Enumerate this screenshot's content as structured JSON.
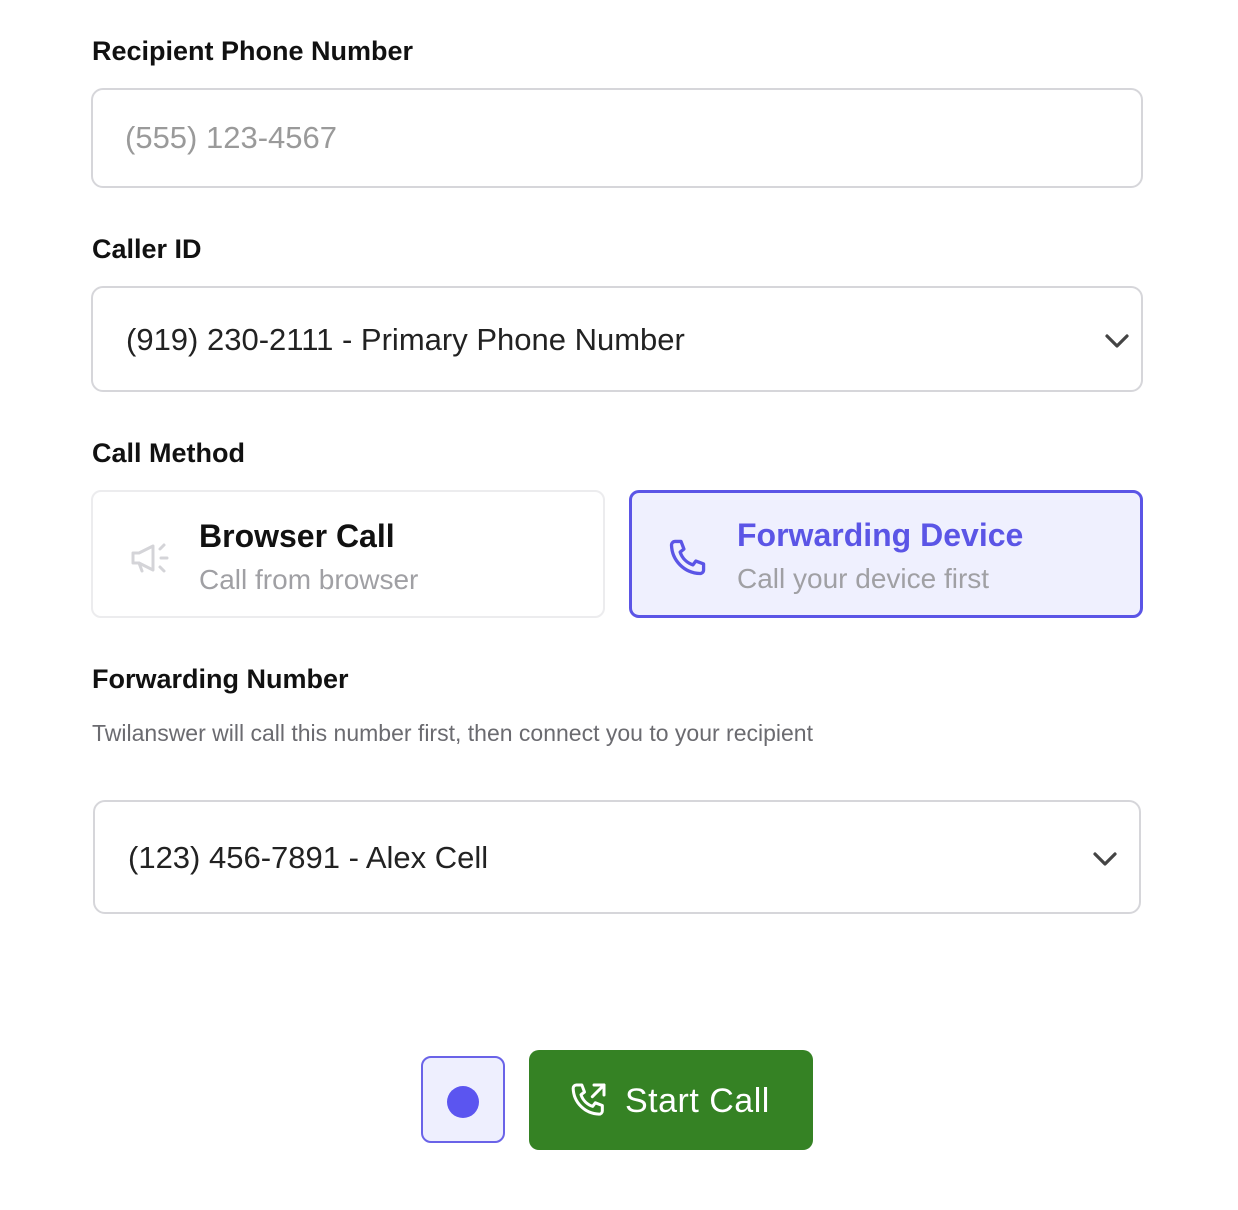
{
  "recipient": {
    "label": "Recipient Phone Number",
    "placeholder": "(555) 123-4567",
    "value": ""
  },
  "caller_id": {
    "label": "Caller ID",
    "selected": "(919) 230-2111 - Primary Phone Number"
  },
  "call_method": {
    "label": "Call Method",
    "options": [
      {
        "title": "Browser Call",
        "subtitle": "Call from browser",
        "icon": "megaphone-icon",
        "selected": false
      },
      {
        "title": "Forwarding Device",
        "subtitle": "Call your device first",
        "icon": "phone-icon",
        "selected": true
      }
    ]
  },
  "forwarding": {
    "label": "Forwarding Number",
    "help": "Twilanswer will call this number first, then connect you to your recipient",
    "selected": "(123) 456-7891 - Alex Cell"
  },
  "actions": {
    "record_icon": "record-dot-icon",
    "start_label": "Start Call",
    "start_icon": "phone-outgoing-icon"
  },
  "colors": {
    "accent": "#5b55e6",
    "accent_bg": "#eff0fe",
    "start_button": "#358224",
    "border": "#d6d6da"
  }
}
